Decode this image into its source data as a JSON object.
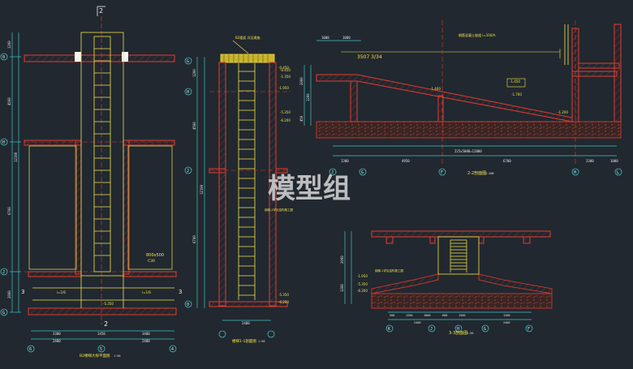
{
  "watermark": "模型组",
  "section_marks": {
    "plan_top": "2",
    "plan_bottom": "2",
    "plan_left": "3",
    "plan_right": "3"
  },
  "colors": {
    "background": "#212830",
    "wall": "#e23b2e",
    "stair": "#f2e24a",
    "dimension": "#3fc3c3",
    "grid_axis": "#e23b2e",
    "hatch": "#7c1f19",
    "text": "#e8e8e8"
  },
  "plan": {
    "title": "B2楼梯大样平面图",
    "scale": "1:50",
    "grid_left": [
      "0",
      "H",
      "J",
      "G"
    ],
    "bottom_axes": [
      "6",
      "5",
      "4"
    ],
    "dims_left": [
      "1200",
      "4500",
      "12190",
      "6700",
      "2800"
    ],
    "dims_bottom": [
      "3300",
      "1450",
      "3400",
      "2400",
      "2400"
    ],
    "note": "800x500",
    "note2": "C30",
    "level_marks": [
      "-5.350",
      "i=1/6",
      "i=1/6"
    ]
  },
  "section1": {
    "title": "楼梯1-1剖面图",
    "scale": "1:50",
    "top_note": "B2楼面 详见建施",
    "side_note": "钢梯-1详见结构施工图",
    "levels": [
      "-0.450",
      "-1.950",
      "-5.350",
      "-6.200"
    ],
    "dims_left": [
      "1200",
      "4500",
      "12190",
      "6700"
    ],
    "dims_bottom": [
      "2400"
    ],
    "axes": [
      "G",
      "H",
      "J",
      "0"
    ]
  },
  "section2": {
    "title": "2-2剖面图",
    "scale": "1:100",
    "top_dims": [
      "1000",
      "1000"
    ],
    "slope_note": "3507 3/34",
    "top_note": "钢筋混凝土坡道 i=100/A",
    "levels": [
      "-0.450",
      "-1.350",
      "-1.450",
      "-1.700",
      "-1.400",
      "-5.350",
      "-6.200",
      "-1.200"
    ],
    "dims_left": [
      "2000",
      "1200",
      "450"
    ],
    "dims_bottom_top": "225x5000=12000",
    "dims_bottom": [
      "1300",
      "4950",
      "6700",
      "3300",
      "1000"
    ],
    "axes": [
      "J",
      "G",
      "F",
      "H",
      "L"
    ]
  },
  "section3": {
    "title": "3-3剖面图",
    "scale": "1:50",
    "levels": [
      "-1.950",
      "-5.350",
      "-6.200"
    ],
    "note": "钢梯-1详见结构施工图",
    "dims_left": [
      "2000",
      "1200"
    ],
    "dims_bottom": [
      "500",
      "1200",
      "1800",
      "600",
      "1500",
      "1200",
      "2400",
      "2400"
    ],
    "axes": [
      "K",
      "J",
      "H",
      "G",
      "F"
    ]
  }
}
